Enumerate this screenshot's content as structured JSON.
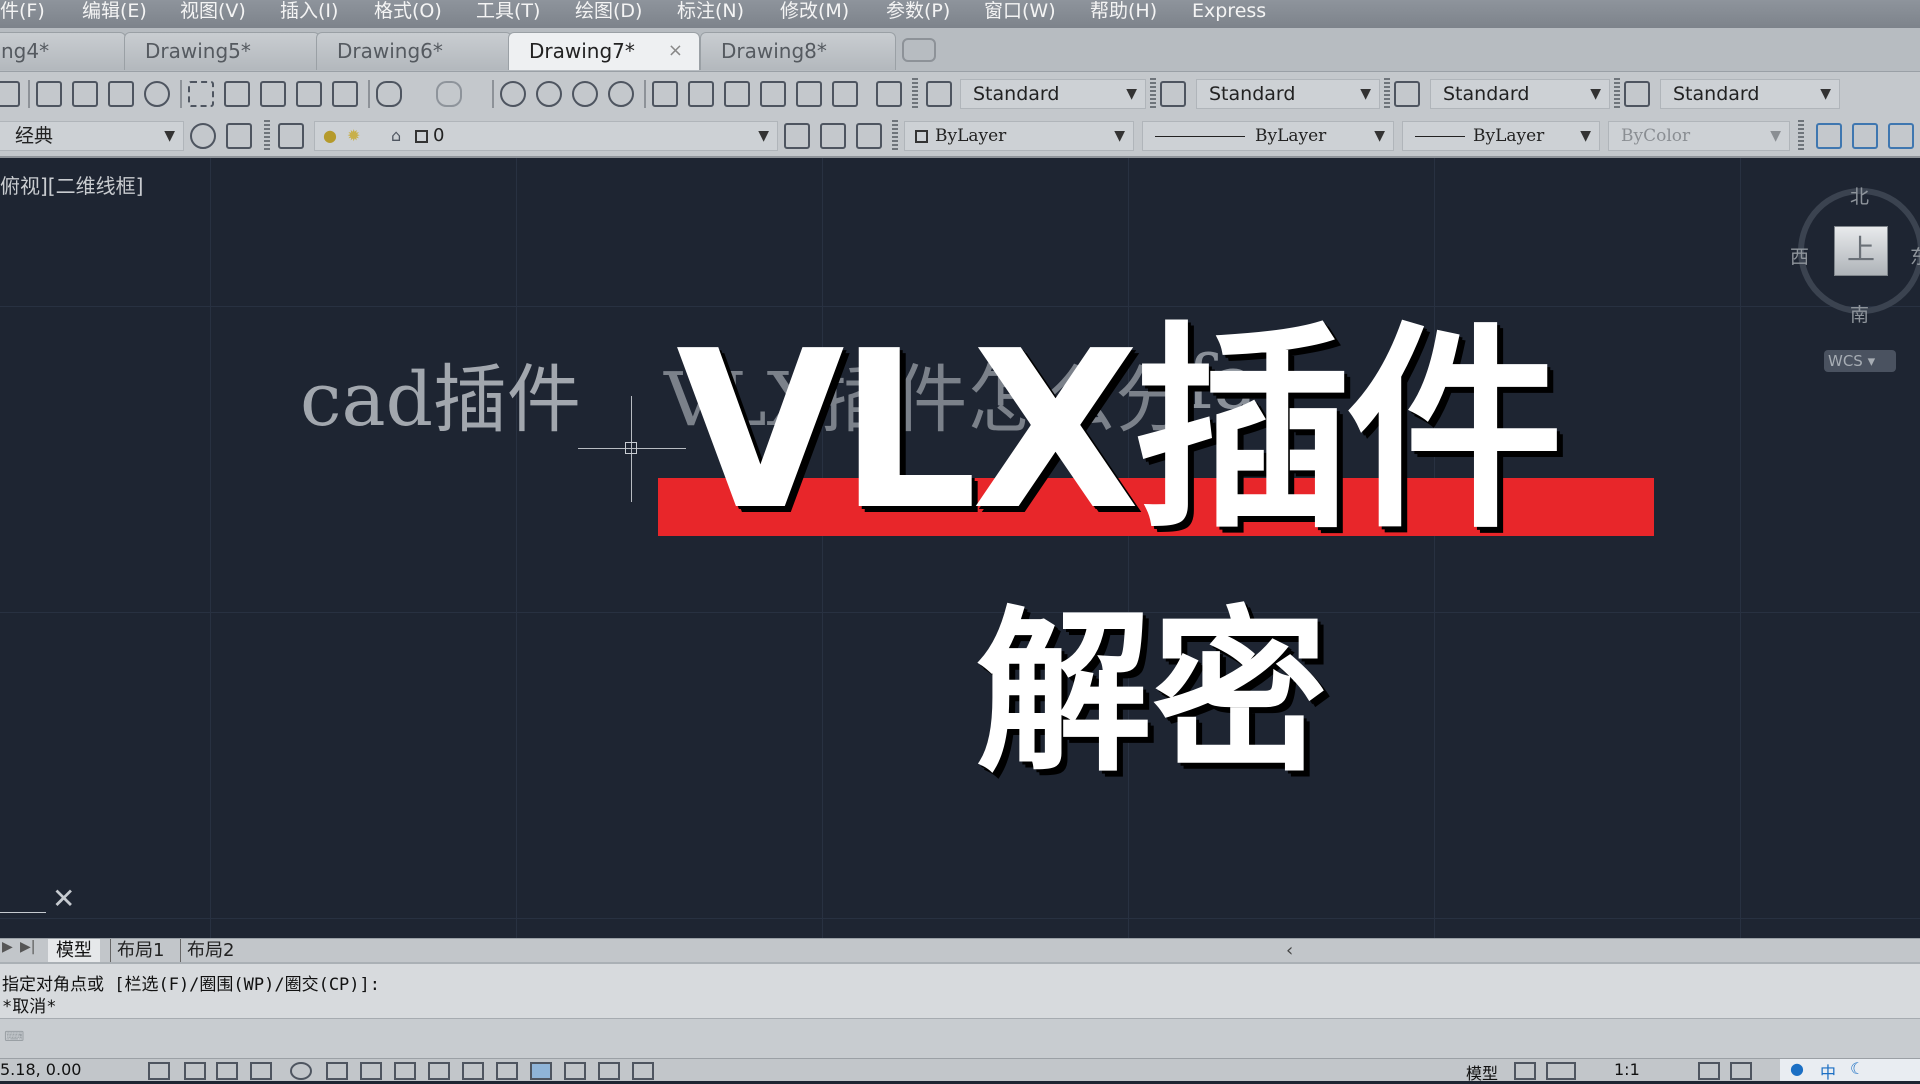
{
  "menu": {
    "items": [
      "件(F)",
      "编辑(E)",
      "视图(V)",
      "插入(I)",
      "格式(O)",
      "工具(T)",
      "绘图(D)",
      "标注(N)",
      "修改(M)",
      "参数(P)",
      "窗口(W)",
      "帮助(H)",
      "Express"
    ]
  },
  "tabs": {
    "items": [
      {
        "label": "ng4*"
      },
      {
        "label": "Drawing5*"
      },
      {
        "label": "Drawing6*"
      },
      {
        "label": "Drawing7*",
        "close": "×"
      },
      {
        "label": "Drawing8*"
      }
    ]
  },
  "styles": {
    "text_style": "Standard",
    "dim_style": "Standard",
    "table_style": "Standard",
    "multileader_style": "Standard"
  },
  "layers": {
    "workspace": "经典",
    "current_layer": "0",
    "color": "ByLayer",
    "linetype": "ByLayer",
    "lineweight": "ByLayer",
    "plotstyle": "ByColor"
  },
  "viewport": {
    "label": "俯视][二维线框]"
  },
  "viewcube": {
    "north": "北",
    "south": "南",
    "west": "西",
    "east": "东",
    "face": "上",
    "wcs": "WCS"
  },
  "canvas_text": {
    "line1": "cad插件",
    "line2": "VLX插件怎么分",
    "line3": "fa"
  },
  "overlay": {
    "title": "VLX插件",
    "subtitle": "解密",
    "bar_color": "#e8262a"
  },
  "layout_tabs": {
    "items": [
      "模型",
      "布局1",
      "布局2"
    ]
  },
  "command": {
    "line1": "指定对角点或 [栏选(F)/圈围(WP)/圈交(CP)]:",
    "line2": "*取消*"
  },
  "status": {
    "coords": "5.18, 0.00",
    "model_label": "模型",
    "scale": "1:1"
  },
  "ime": {
    "lang": "中"
  }
}
